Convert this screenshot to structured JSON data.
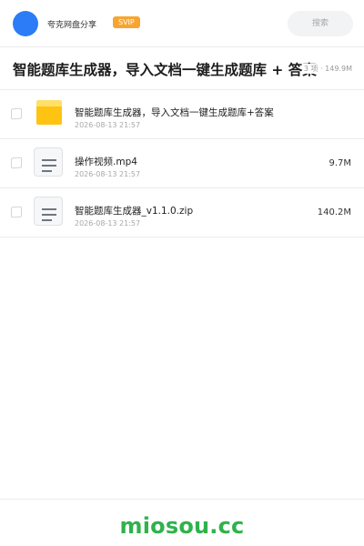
{
  "header": {
    "app_name": "夸克网盘分享",
    "badge": "SVIP",
    "search_placeholder": "搜索",
    "accent": "#2b7cf6",
    "badge_color": "#f7a530"
  },
  "share": {
    "title": "智能题库生成器，导入文档一键生成题库 + 答案",
    "summary": "3 项 · 149.9M"
  },
  "files": [
    {
      "name": "智能题库生成器，导入文档一键生成题库+答案",
      "date": "2026-08-13 21:57",
      "size": "",
      "icon": "folder-icon"
    },
    {
      "name": "操作视频.mp4",
      "date": "2026-08-13 21:57",
      "size": "9.7M",
      "icon": "file-icon"
    },
    {
      "name": "智能题库生成器_v1.1.0.zip",
      "date": "2026-08-13 21:57",
      "size": "140.2M",
      "icon": "file-icon"
    }
  ],
  "footer": {
    "watermark": "miosou.cc",
    "watermark_color": "#2fb24c"
  }
}
